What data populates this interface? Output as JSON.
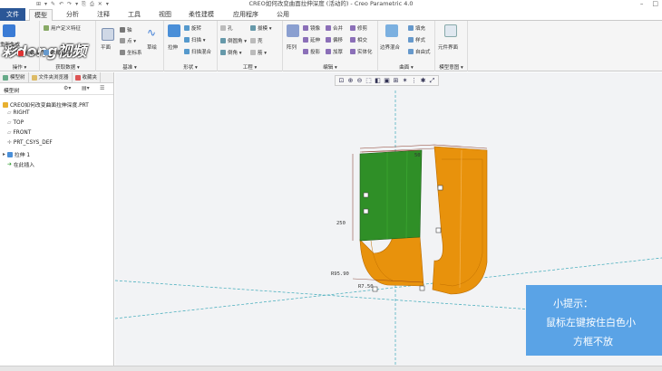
{
  "window": {
    "title": "CREO如何改变曲面拉伸深度 (活动的) - Creo Parametric 4.0",
    "quick_access": [
      "⊞",
      "▾",
      "✎",
      "↶",
      "↷",
      "▾",
      "⎘",
      "⎙",
      "✕",
      "▾"
    ]
  },
  "tabs": [
    "文件",
    "模型",
    "分析",
    "注释",
    "工具",
    "视图",
    "柔性建模",
    "应用程序",
    "公用"
  ],
  "ribbon": {
    "groups": {
      "operations": "操作 ▾",
      "get_data": "获取数据 ▾",
      "datum": "基准 ▾",
      "shapes": "形状 ▾",
      "engineering": "工程 ▾",
      "editing": "编辑 ▾",
      "surfaces": "曲面 ▾",
      "model_intent": "模型意图 ▾"
    },
    "items": {
      "regenerate": "重新生成",
      "delete": "删除 ▾",
      "user_defined_feature": "用户定义特征",
      "shrinkwrap": "收缩包络",
      "plane": "平面",
      "axis": "轴",
      "point": "点 ▾",
      "coordinate_system": "坐标系",
      "sketch": "草绘",
      "extrude": "拉伸",
      "revolve": "旋转",
      "sweep": "扫描 ▾",
      "swept_blend": "扫描混合",
      "hole": "孔",
      "draft": "拔模 ▾",
      "round": "倒圆角 ▾",
      "shell": "壳",
      "chamfer": "倒角 ▾",
      "rib": "筋 ▾",
      "pattern": "阵列",
      "mirror": "镜像",
      "merge": "合并",
      "trim": "修剪",
      "extend": "延伸",
      "intersect": "相交",
      "offset": "偏移",
      "project": "投影",
      "thicken": "加厚",
      "solidify": "实体化",
      "boundary_blend": "边界混合",
      "fill": "填充",
      "style": "样式",
      "freestyle": "自由式",
      "component_interface": "元件界面"
    }
  },
  "left_panel": {
    "tabs": [
      "模型树",
      "文件夹浏览器",
      "收藏夹"
    ],
    "header": "模型树",
    "tree": [
      "CREO如何改变曲面拉伸深度.PRT",
      "RIGHT",
      "TOP",
      "FRONT",
      "PRT_CSYS_DEF",
      "拉伸 1",
      "在此插入"
    ]
  },
  "viewport": {
    "dimensions": [
      "250",
      "50",
      "250",
      "R95.90",
      "R7.50"
    ],
    "tools": [
      "⊡",
      "⊕",
      "⊖",
      "⬚",
      "◧",
      "▣",
      "⊞",
      "✶",
      "⋮",
      "✱",
      "⤢"
    ]
  },
  "hint": {
    "line1": "小提示：",
    "line2": "鼠标左键按住白色小",
    "line3": "方框不放"
  },
  "watermark": "彩dong视频",
  "colors": {
    "file_tab": "#2b5797",
    "surface_orange": "#e8920c",
    "surface_green": "#3a9a2e",
    "hint_bg": "#5aa3e6"
  }
}
